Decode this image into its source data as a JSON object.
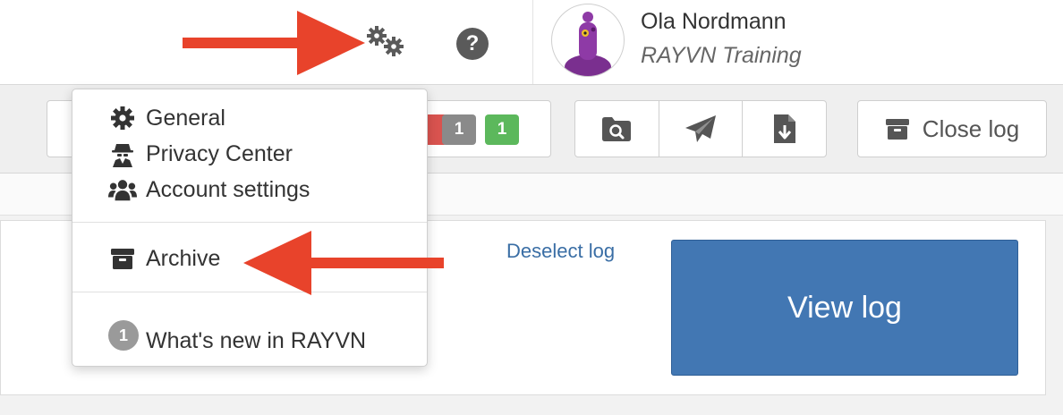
{
  "header": {
    "user_name": "Ola Nordmann",
    "user_org": "RAYVN Training",
    "help_glyph": "?",
    "icons": {
      "settings": "gears-icon",
      "help": "question-circle-icon",
      "avatar": "purple-character-avatar"
    }
  },
  "toolbar": {
    "badges": [
      {
        "value": "1",
        "color": "#8a8a8a"
      },
      {
        "value": "1",
        "color": "#5cb85c"
      }
    ],
    "action_icons": [
      "search-folder-icon",
      "paper-plane-icon",
      "file-download-icon"
    ],
    "close_log_label": "Close log"
  },
  "content": {
    "deselect_label": "Deselect log",
    "view_log_label": "View log"
  },
  "dropdown": {
    "items": [
      {
        "label": "General",
        "icon": "cog-icon"
      },
      {
        "label": "Privacy Center",
        "icon": "user-secret-icon"
      },
      {
        "label": "Account settings",
        "icon": "users-icon"
      },
      {
        "label": "Archive",
        "icon": "archive-box-icon"
      },
      {
        "label": "What's new in RAYVN",
        "icon": "notification-icon"
      }
    ],
    "whats_new_count": "1"
  },
  "colors": {
    "primary_button": "#4277b3",
    "link": "#3a6ea5",
    "annotation_arrow": "#e8432b",
    "badge_red": "#d9534f",
    "badge_gray": "#8a8a8a",
    "badge_green": "#5cb85c"
  }
}
